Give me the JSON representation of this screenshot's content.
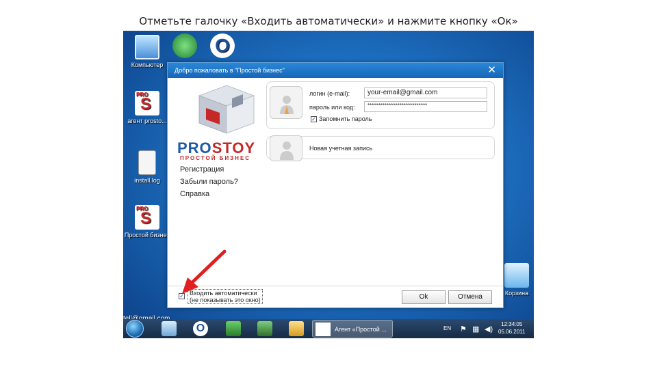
{
  "caption": "Отметьте галочку «Входить автоматически» и нажмите кнопку «Ок»",
  "desktop": {
    "icons": [
      {
        "label": "Компьютер",
        "icon": "computer-icon"
      },
      {
        "label": "",
        "icon": "network-icon"
      },
      {
        "label": "",
        "icon": "opera-icon"
      },
      {
        "label": "агент prosto...",
        "icon": "prostoy-agent-icon"
      },
      {
        "label": "install.log",
        "icon": "file-icon"
      },
      {
        "label": "Простой бизнес",
        "icon": "prostoy-business-icon"
      },
      {
        "label": "Корзина",
        "icon": "recycle-bin-icon"
      }
    ],
    "stray_text": "tell@gmail.com"
  },
  "dialog": {
    "title": "Добро пожаловать в \"Простой бизнес\"",
    "close": "✕",
    "logo": {
      "pro": "PRO",
      "stoy": "STOY",
      "subtitle": "ПРОСТОЙ БИЗНЕС"
    },
    "links": [
      "Регистрация",
      "Забыли пароль?",
      "Справка"
    ],
    "login_label": "логин (e-mail):",
    "login_value": "your-email@gmail.com",
    "password_label": "пароль или код:",
    "password_value": "****************************",
    "remember_label": "Запомнить пароль",
    "remember_checked": true,
    "new_account_label": "Новая учетная запись",
    "auto_login_label": "Входить автоматически",
    "auto_login_sub": "(не показывать это окно)",
    "auto_login_checked": true,
    "ok_label": "Ok",
    "cancel_label": "Отмена"
  },
  "taskbar": {
    "task_label": "Агент «Простой ...",
    "lang": "EN",
    "time": "12:34:05",
    "date": "05.06.2011"
  },
  "colors": {
    "accent": "#1666b8",
    "brand_red": "#c62828",
    "brand_blue": "#1e5aa8",
    "arrow": "#e02020"
  }
}
